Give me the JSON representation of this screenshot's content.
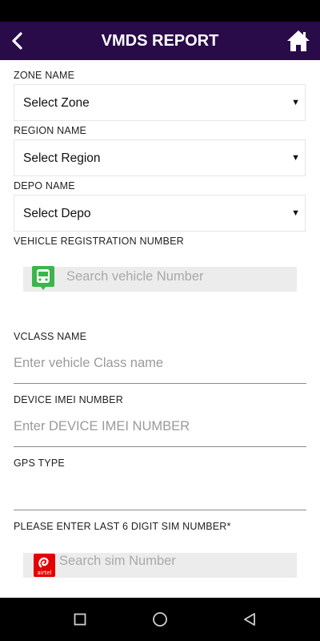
{
  "header": {
    "title": "VMDS REPORT",
    "back_icon": "chevron-left-icon",
    "home_icon": "home-icon",
    "bg_color": "#2a0b4a"
  },
  "form": {
    "zone": {
      "label": "ZONE NAME",
      "value": "Select Zone"
    },
    "region": {
      "label": "REGION NAME",
      "value": "Select Region"
    },
    "depo": {
      "label": "DEPO NAME",
      "value": "Select Depo"
    },
    "vehicle_reg": {
      "label": "VEHICLE REGISTRATION NUMBER",
      "placeholder": "Search vehicle Number",
      "icon": "bus-icon"
    },
    "vclass": {
      "label": "VCLASS NAME",
      "placeholder": "Enter vehicle Class name"
    },
    "imei": {
      "label": "DEVICE IMEI NUMBER",
      "placeholder": "Enter DEVICE IMEI NUMBER"
    },
    "gps": {
      "label": "GPS TYPE",
      "value": ""
    },
    "sim": {
      "label": "PLEASE ENTER LAST 6 DIGIT SIM NUMBER*",
      "placeholder": "Search sim Number",
      "icon_text": "airtel"
    }
  },
  "nav": {
    "recent_icon": "square-icon",
    "home_icon": "circle-icon",
    "back_icon": "triangle-back-icon"
  }
}
